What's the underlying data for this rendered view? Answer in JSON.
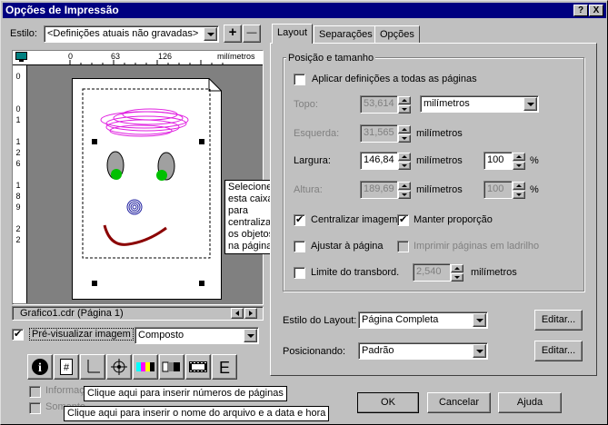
{
  "window": {
    "title": "Opções de Impressão",
    "help_button": "?",
    "close_button": "X"
  },
  "style": {
    "label": "Estilo:",
    "value": "<Definições atuais não gravadas>",
    "add": "+",
    "remove": "—"
  },
  "ruler": {
    "ticks": [
      "0",
      "63",
      "126"
    ],
    "unit": "milímetros",
    "vticks": [
      "0",
      "1",
      "2",
      "3",
      "4",
      "5",
      "6",
      "7",
      "8",
      "9",
      "1",
      "2",
      "1",
      "6",
      "1",
      "8",
      "2",
      "2"
    ]
  },
  "preview": {
    "file_label": "Grafico1.cdr (Página 1)",
    "checkbox_label": "Pré-visualizar imagem",
    "checked": true,
    "mode": "Composto"
  },
  "tooltips": {
    "center": "Selecione\nesta caixa\npara\ncentralizar\nos objetos\nna página",
    "page_numbers": "Clique aqui para inserir números de páginas",
    "file_info": "Clique aqui para inserir o nome do arquivo e a data e hora"
  },
  "bottom_checks": {
    "info": "Informações",
    "some": "Somente..."
  },
  "tabs": [
    "Layout",
    "Separações",
    "Opções"
  ],
  "layout": {
    "group_title": "Posição e tamanho",
    "apply_all": "Aplicar definições a todas as páginas",
    "top": {
      "label": "Topo:",
      "value": "53,614",
      "unit": "milímetros"
    },
    "left": {
      "label": "Esquerda:",
      "value": "31,565",
      "unit": "milímetros"
    },
    "width": {
      "label": "Largura:",
      "value": "146,84",
      "unit": "milímetros",
      "pct": "100",
      "pct_unit": "%"
    },
    "height": {
      "label": "Altura:",
      "value": "189,69",
      "unit": "milímetros",
      "pct": "100",
      "pct_unit": "%"
    },
    "center_image": "Centralizar imagem",
    "keep_ratio": "Manter proporção",
    "fit_page": "Ajustar à página",
    "tile_pages": "Imprimir páginas em ladrilho",
    "bleed": {
      "label": "Limite do transbord.",
      "value": "2,540",
      "unit": "milímetros"
    },
    "layout_style": {
      "label": "Estilo do Layout:",
      "value": "Página Completa",
      "edit": "Editar..."
    },
    "positioning": {
      "label": "Posicionando:",
      "value": "Padrão",
      "edit": "Editar..."
    }
  },
  "buttons": {
    "ok": "OK",
    "cancel": "Cancelar",
    "help": "Ajuda"
  },
  "toolbar_icons": [
    "info-icon",
    "page-number-icon",
    "crop-marks-icon",
    "registration-mark-icon",
    "color-bars-icon",
    "densitometer-icon",
    "film-strip-icon",
    "emulsion-icon"
  ],
  "toolbar_glyphs": [
    "i",
    "#",
    "|_",
    "⊕",
    "▮▮",
    "◧",
    "▦",
    "E"
  ]
}
